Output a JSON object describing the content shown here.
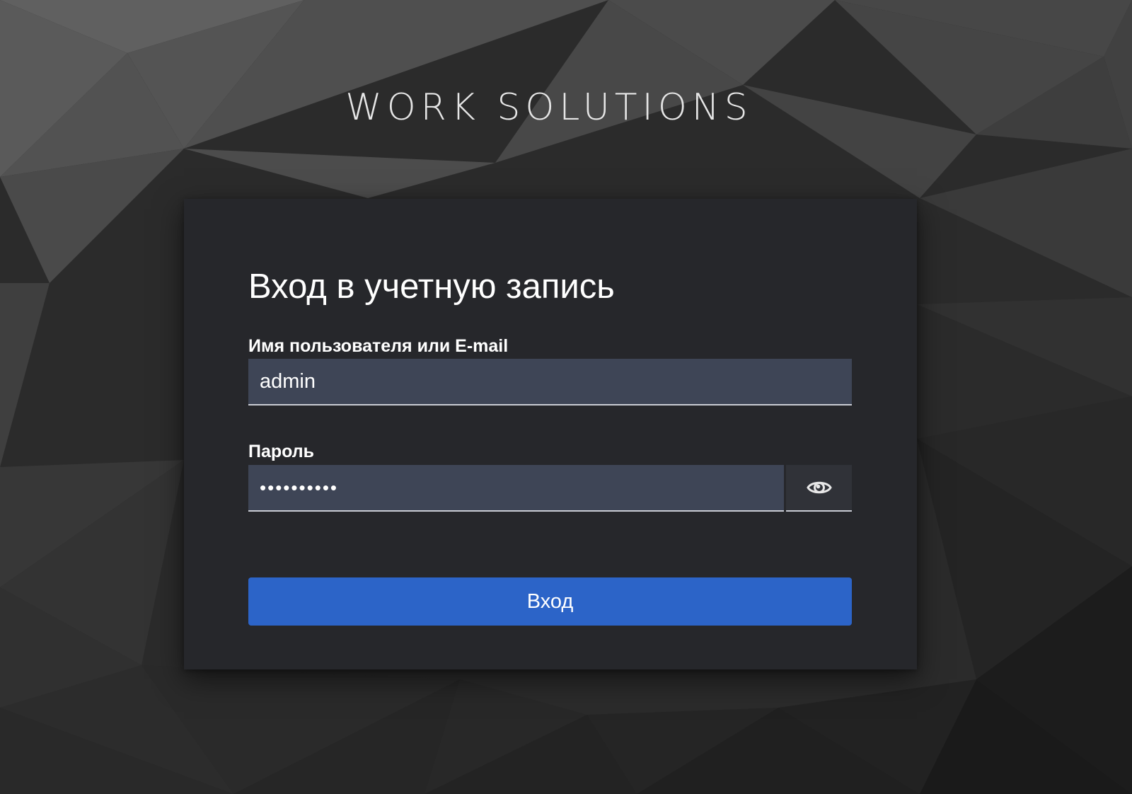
{
  "brand": {
    "name": "WORK SOLUTIONS"
  },
  "login": {
    "title": "Вход в учетную запись",
    "username": {
      "label": "Имя пользователя или E-mail",
      "value": "admin"
    },
    "password": {
      "label": "Пароль",
      "value": "••••••••••",
      "toggle_icon": "eye-icon"
    },
    "submit_label": "Вход"
  },
  "colors": {
    "card_background": "#26272b",
    "input_background": "#3e4556",
    "input_underline": "#c9ccd4",
    "primary_button": "#2c64c8",
    "page_background": "#2b2b2b"
  }
}
